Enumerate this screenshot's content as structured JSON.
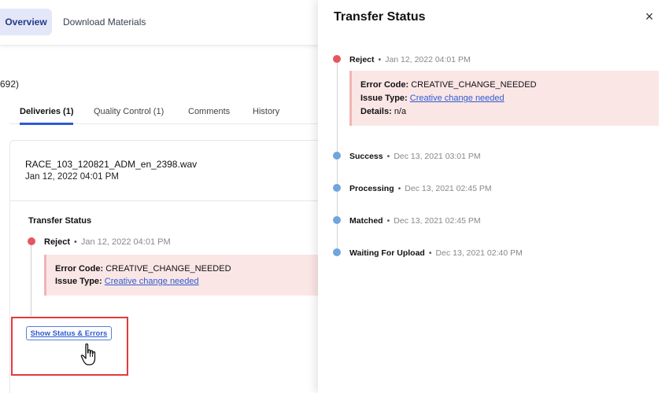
{
  "left": {
    "tabs": {
      "overview": "Overview",
      "download": "Download Materials"
    },
    "count_fragment": "692)",
    "subtabs": [
      {
        "label": "Deliveries (1)"
      },
      {
        "label": "Quality Control (1)"
      },
      {
        "label": "Comments"
      },
      {
        "label": "History"
      }
    ],
    "card": {
      "filename": "RACE_103_120821_ADM_en_2398.wav",
      "date": "Jan 12, 2022 04:01 PM",
      "transfer_title": "Transfer Status",
      "latest": {
        "status": "Reject",
        "sep": "•",
        "time": "Jan 12, 2022 04:01 PM"
      },
      "error": {
        "code_label": "Error Code:",
        "code_value": "CREATIVE_CHANGE_NEEDED",
        "issue_label": "Issue Type:",
        "issue_value": "Creative change needed"
      },
      "show_button": "Show Status & Errors"
    }
  },
  "panel": {
    "title": "Transfer Status",
    "close": "×",
    "error": {
      "code_label": "Error Code:",
      "code_value": "CREATIVE_CHANGE_NEEDED",
      "issue_label": "Issue Type:",
      "issue_value": "Creative change needed",
      "details_label": "Details:",
      "details_value": "n/a"
    },
    "events": [
      {
        "status": "Reject",
        "sep": "•",
        "time": "Jan 12, 2022 04:01 PM",
        "color": "#e5575f"
      },
      {
        "status": "Success",
        "sep": "•",
        "time": "Dec 13, 2021 03:01 PM",
        "color": "#6fa6dc"
      },
      {
        "status": "Processing",
        "sep": "•",
        "time": "Dec 13, 2021 02:45 PM",
        "color": "#6fa6dc"
      },
      {
        "status": "Matched",
        "sep": "•",
        "time": "Dec 13, 2021 02:45 PM",
        "color": "#6fa6dc"
      },
      {
        "status": "Waiting For Upload",
        "sep": "•",
        "time": "Dec 13, 2021 02:40 PM",
        "color": "#6fa6dc"
      }
    ]
  }
}
